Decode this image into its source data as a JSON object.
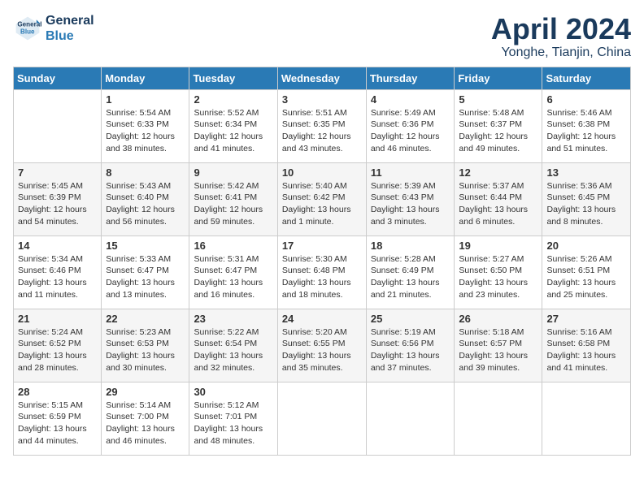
{
  "header": {
    "logo_line1": "General",
    "logo_line2": "Blue",
    "month": "April 2024",
    "location": "Yonghe, Tianjin, China"
  },
  "weekdays": [
    "Sunday",
    "Monday",
    "Tuesday",
    "Wednesday",
    "Thursday",
    "Friday",
    "Saturday"
  ],
  "weeks": [
    [
      {
        "date": "",
        "info": ""
      },
      {
        "date": "1",
        "info": "Sunrise: 5:54 AM\nSunset: 6:33 PM\nDaylight: 12 hours\nand 38 minutes."
      },
      {
        "date": "2",
        "info": "Sunrise: 5:52 AM\nSunset: 6:34 PM\nDaylight: 12 hours\nand 41 minutes."
      },
      {
        "date": "3",
        "info": "Sunrise: 5:51 AM\nSunset: 6:35 PM\nDaylight: 12 hours\nand 43 minutes."
      },
      {
        "date": "4",
        "info": "Sunrise: 5:49 AM\nSunset: 6:36 PM\nDaylight: 12 hours\nand 46 minutes."
      },
      {
        "date": "5",
        "info": "Sunrise: 5:48 AM\nSunset: 6:37 PM\nDaylight: 12 hours\nand 49 minutes."
      },
      {
        "date": "6",
        "info": "Sunrise: 5:46 AM\nSunset: 6:38 PM\nDaylight: 12 hours\nand 51 minutes."
      }
    ],
    [
      {
        "date": "7",
        "info": "Sunrise: 5:45 AM\nSunset: 6:39 PM\nDaylight: 12 hours\nand 54 minutes."
      },
      {
        "date": "8",
        "info": "Sunrise: 5:43 AM\nSunset: 6:40 PM\nDaylight: 12 hours\nand 56 minutes."
      },
      {
        "date": "9",
        "info": "Sunrise: 5:42 AM\nSunset: 6:41 PM\nDaylight: 12 hours\nand 59 minutes."
      },
      {
        "date": "10",
        "info": "Sunrise: 5:40 AM\nSunset: 6:42 PM\nDaylight: 13 hours\nand 1 minute."
      },
      {
        "date": "11",
        "info": "Sunrise: 5:39 AM\nSunset: 6:43 PM\nDaylight: 13 hours\nand 3 minutes."
      },
      {
        "date": "12",
        "info": "Sunrise: 5:37 AM\nSunset: 6:44 PM\nDaylight: 13 hours\nand 6 minutes."
      },
      {
        "date": "13",
        "info": "Sunrise: 5:36 AM\nSunset: 6:45 PM\nDaylight: 13 hours\nand 8 minutes."
      }
    ],
    [
      {
        "date": "14",
        "info": "Sunrise: 5:34 AM\nSunset: 6:46 PM\nDaylight: 13 hours\nand 11 minutes."
      },
      {
        "date": "15",
        "info": "Sunrise: 5:33 AM\nSunset: 6:47 PM\nDaylight: 13 hours\nand 13 minutes."
      },
      {
        "date": "16",
        "info": "Sunrise: 5:31 AM\nSunset: 6:47 PM\nDaylight: 13 hours\nand 16 minutes."
      },
      {
        "date": "17",
        "info": "Sunrise: 5:30 AM\nSunset: 6:48 PM\nDaylight: 13 hours\nand 18 minutes."
      },
      {
        "date": "18",
        "info": "Sunrise: 5:28 AM\nSunset: 6:49 PM\nDaylight: 13 hours\nand 21 minutes."
      },
      {
        "date": "19",
        "info": "Sunrise: 5:27 AM\nSunset: 6:50 PM\nDaylight: 13 hours\nand 23 minutes."
      },
      {
        "date": "20",
        "info": "Sunrise: 5:26 AM\nSunset: 6:51 PM\nDaylight: 13 hours\nand 25 minutes."
      }
    ],
    [
      {
        "date": "21",
        "info": "Sunrise: 5:24 AM\nSunset: 6:52 PM\nDaylight: 13 hours\nand 28 minutes."
      },
      {
        "date": "22",
        "info": "Sunrise: 5:23 AM\nSunset: 6:53 PM\nDaylight: 13 hours\nand 30 minutes."
      },
      {
        "date": "23",
        "info": "Sunrise: 5:22 AM\nSunset: 6:54 PM\nDaylight: 13 hours\nand 32 minutes."
      },
      {
        "date": "24",
        "info": "Sunrise: 5:20 AM\nSunset: 6:55 PM\nDaylight: 13 hours\nand 35 minutes."
      },
      {
        "date": "25",
        "info": "Sunrise: 5:19 AM\nSunset: 6:56 PM\nDaylight: 13 hours\nand 37 minutes."
      },
      {
        "date": "26",
        "info": "Sunrise: 5:18 AM\nSunset: 6:57 PM\nDaylight: 13 hours\nand 39 minutes."
      },
      {
        "date": "27",
        "info": "Sunrise: 5:16 AM\nSunset: 6:58 PM\nDaylight: 13 hours\nand 41 minutes."
      }
    ],
    [
      {
        "date": "28",
        "info": "Sunrise: 5:15 AM\nSunset: 6:59 PM\nDaylight: 13 hours\nand 44 minutes."
      },
      {
        "date": "29",
        "info": "Sunrise: 5:14 AM\nSunset: 7:00 PM\nDaylight: 13 hours\nand 46 minutes."
      },
      {
        "date": "30",
        "info": "Sunrise: 5:12 AM\nSunset: 7:01 PM\nDaylight: 13 hours\nand 48 minutes."
      },
      {
        "date": "",
        "info": ""
      },
      {
        "date": "",
        "info": ""
      },
      {
        "date": "",
        "info": ""
      },
      {
        "date": "",
        "info": ""
      }
    ]
  ]
}
